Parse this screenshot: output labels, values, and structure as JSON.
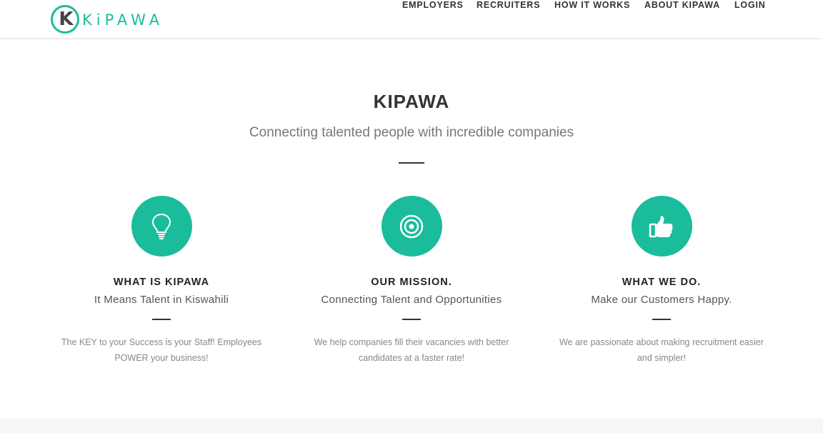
{
  "brand": {
    "logo_letter": "K",
    "logo_text": "KiPAWA"
  },
  "nav": {
    "items": [
      {
        "label": "EMPLOYERS"
      },
      {
        "label": "RECRUITERS"
      },
      {
        "label": "HOW IT WORKS"
      },
      {
        "label": "ABOUT KIPAWA"
      },
      {
        "label": "LOGIN"
      }
    ]
  },
  "hero": {
    "title": "KIPAWA",
    "subtitle": "Connecting talented people with incredible companies"
  },
  "features": [
    {
      "icon": "lightbulb-icon",
      "title": "WHAT IS KIPAWA",
      "subtitle": "It Means Talent in Kiswahili",
      "text": "The KEY to your Success is your Staff! Employees POWER your business!"
    },
    {
      "icon": "target-icon",
      "title": "OUR MISSION.",
      "subtitle": "Connecting Talent and Opportunities",
      "text": "We help companies fill their vacancies with better candidates at a faster rate!"
    },
    {
      "icon": "thumbs-up-icon",
      "title": "WHAT WE DO.",
      "subtitle": "Make our Customers Happy.",
      "text": "We are passionate about making recruitment easier and simpler!"
    }
  ],
  "colors": {
    "accent": "#1abc9c",
    "text": "#333333",
    "muted": "#888888"
  }
}
